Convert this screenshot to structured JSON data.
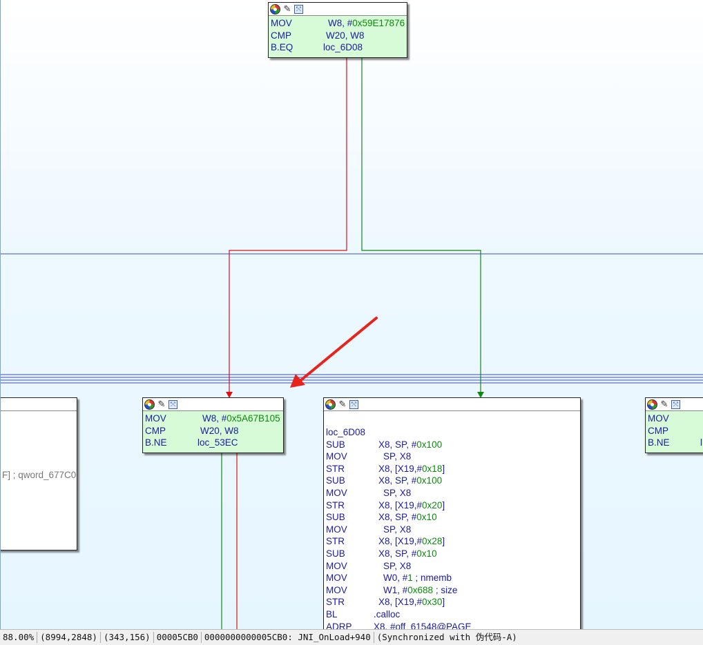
{
  "nodes": {
    "top": {
      "lines": [
        {
          "mn": "MOV",
          "op": "W8, #",
          "num": "0x59E17876"
        },
        {
          "mn": "CMP",
          "op": "W20, W8"
        },
        {
          "mn": "B.EQ",
          "op": "loc_6D08"
        }
      ]
    },
    "left_partial": {
      "comment": "F] ; qword_677C0"
    },
    "mid": {
      "lines": [
        {
          "mn": "MOV",
          "op": "W8, #",
          "num": "0x5A67B105"
        },
        {
          "mn": "CMP",
          "op": "W20, W8"
        },
        {
          "mn": "B.NE",
          "op": "loc_53EC"
        }
      ]
    },
    "right_partial": {
      "lines": [
        {
          "mn": "MOV"
        },
        {
          "mn": "CMP"
        },
        {
          "mn": "B.NE",
          "op": "l"
        }
      ]
    },
    "big": {
      "label": "loc_6D08",
      "lines": [
        {
          "mn": "SUB",
          "op": "X8, SP, #",
          "num": "0x100"
        },
        {
          "mn": "MOV",
          "op": "SP, X8"
        },
        {
          "mn": "STR",
          "op": "X8, [X19,#",
          "num": "0x18",
          "tail": "]"
        },
        {
          "mn": "SUB",
          "op": "X8, SP, #",
          "num": "0x100"
        },
        {
          "mn": "MOV",
          "op": "SP, X8"
        },
        {
          "mn": "STR",
          "op": "X8, [X19,#",
          "num": "0x20",
          "tail": "]"
        },
        {
          "mn": "SUB",
          "op": "X8, SP, #",
          "num": "0x10"
        },
        {
          "mn": "MOV",
          "op": "SP, X8"
        },
        {
          "mn": "STR",
          "op": "X8, [X19,#",
          "num": "0x28",
          "tail": "]"
        },
        {
          "mn": "SUB",
          "op": "X8, SP, #",
          "num": "0x10"
        },
        {
          "mn": "MOV",
          "op": "SP, X8"
        },
        {
          "mn": "MOV",
          "op": "W0, #",
          "num": "1",
          "tail": "  ; nmemb"
        },
        {
          "mn": "MOV",
          "op": "W1, #",
          "num": "0x688",
          "tail": " ; size"
        },
        {
          "mn": "STR",
          "op": "X8, [X19,#",
          "num": "0x30",
          "tail": "]"
        },
        {
          "mn": "BL",
          "op": ".calloc"
        },
        {
          "mn": "ADRP",
          "op": "X8, #off_61548@PAGE"
        }
      ]
    }
  },
  "status": {
    "zoom": "88.00%",
    "graph_coords": "(8994,2848)",
    "mouse_coords": "(343,156)",
    "offset": "00005CB0",
    "address": "0000000000005CB0: JNI_OnLoad+940",
    "sync": "(Synchronized with 伪代码-A)"
  },
  "colors": {
    "true_edge": "#118811",
    "false_edge": "#dd1111",
    "arrow": "#e8231c",
    "bus": "#2a3ab0"
  },
  "icons": [
    "color-icon",
    "rename-icon",
    "graph-icon"
  ]
}
